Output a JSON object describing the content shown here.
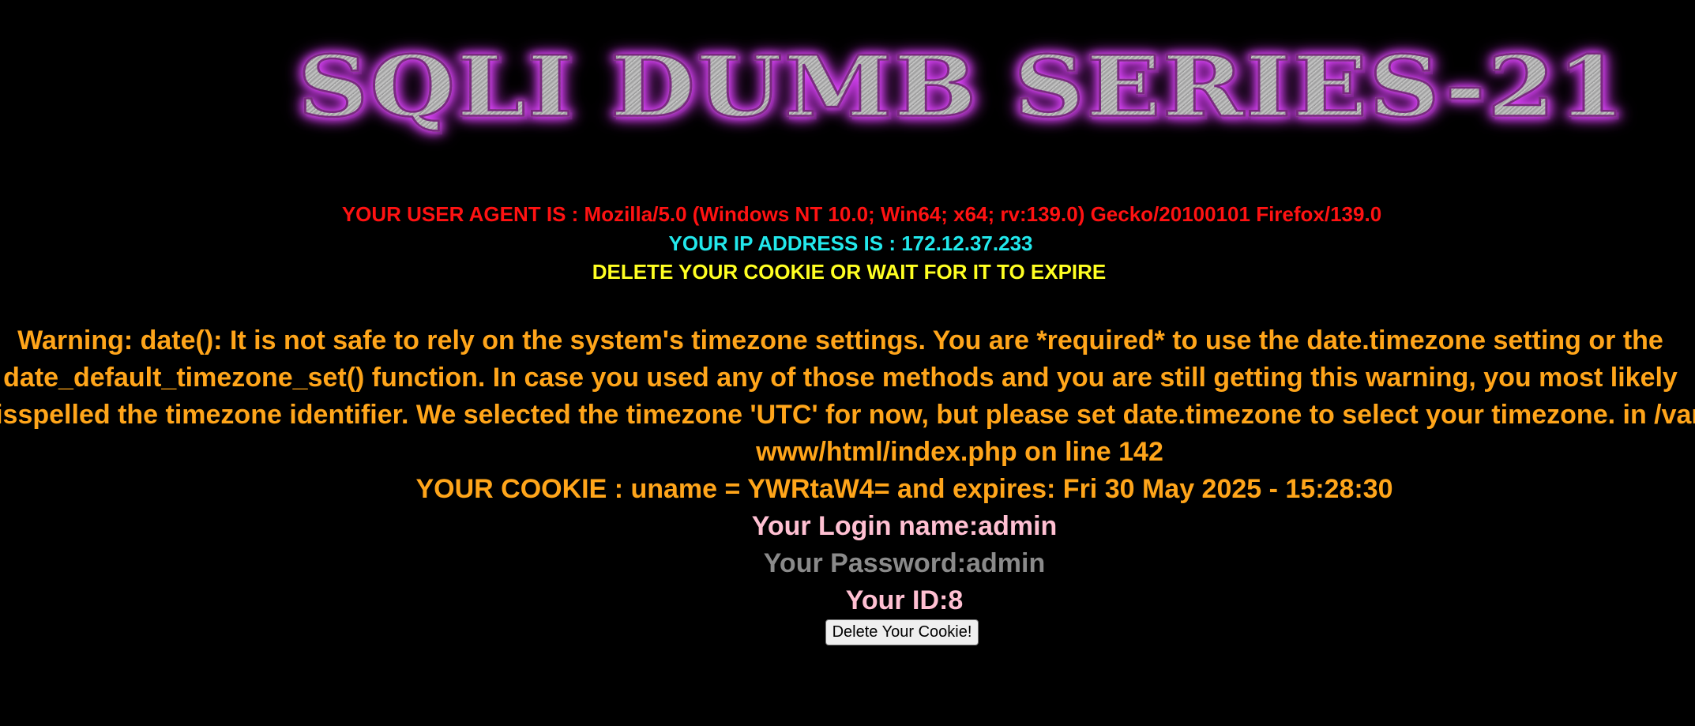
{
  "banner": {
    "title": "SQLI DUMB SERIES-21"
  },
  "info": {
    "user_agent": "YOUR USER AGENT IS : Mozilla/5.0 (Windows NT 10.0; Win64; x64; rv:139.0) Gecko/20100101 Firefox/139.0",
    "ip_address": "YOUR IP ADDRESS IS : 172.12.37.233",
    "cookie_notice": "DELETE YOUR COOKIE OR WAIT FOR IT TO EXPIRE"
  },
  "warning": {
    "line1": "Warning: date(): It is not safe to rely on the system's timezone settings. You are *required* to use the date.timezone setting or the",
    "line2": "date_default_timezone_set() function. In case you used any of those methods and you are still getting this warning, you most likely",
    "line3": "misspelled the timezone identifier. We selected the timezone 'UTC' for now, but please set date.timezone to select your timezone. in /var/",
    "line4": "www/html/index.php on line 142"
  },
  "result": {
    "cookie": "YOUR COOKIE : uname = YWRtaW4= and expires: Fri 30 May 2025 - 15:28:30",
    "login_name": "Your Login name:admin",
    "password": "Your Password:admin",
    "id": "Your ID:8"
  },
  "actions": {
    "delete_cookie_label": "Delete Your Cookie!"
  },
  "colors": {
    "background": "#000000",
    "user_agent": "#ff1212",
    "ip_address": "#22e8ec",
    "cookie_notice": "#ffff22",
    "warning": "#ffa51a",
    "login": "#ffc0d2",
    "password": "#8a8a8a",
    "banner_glow": "#e04cff"
  }
}
